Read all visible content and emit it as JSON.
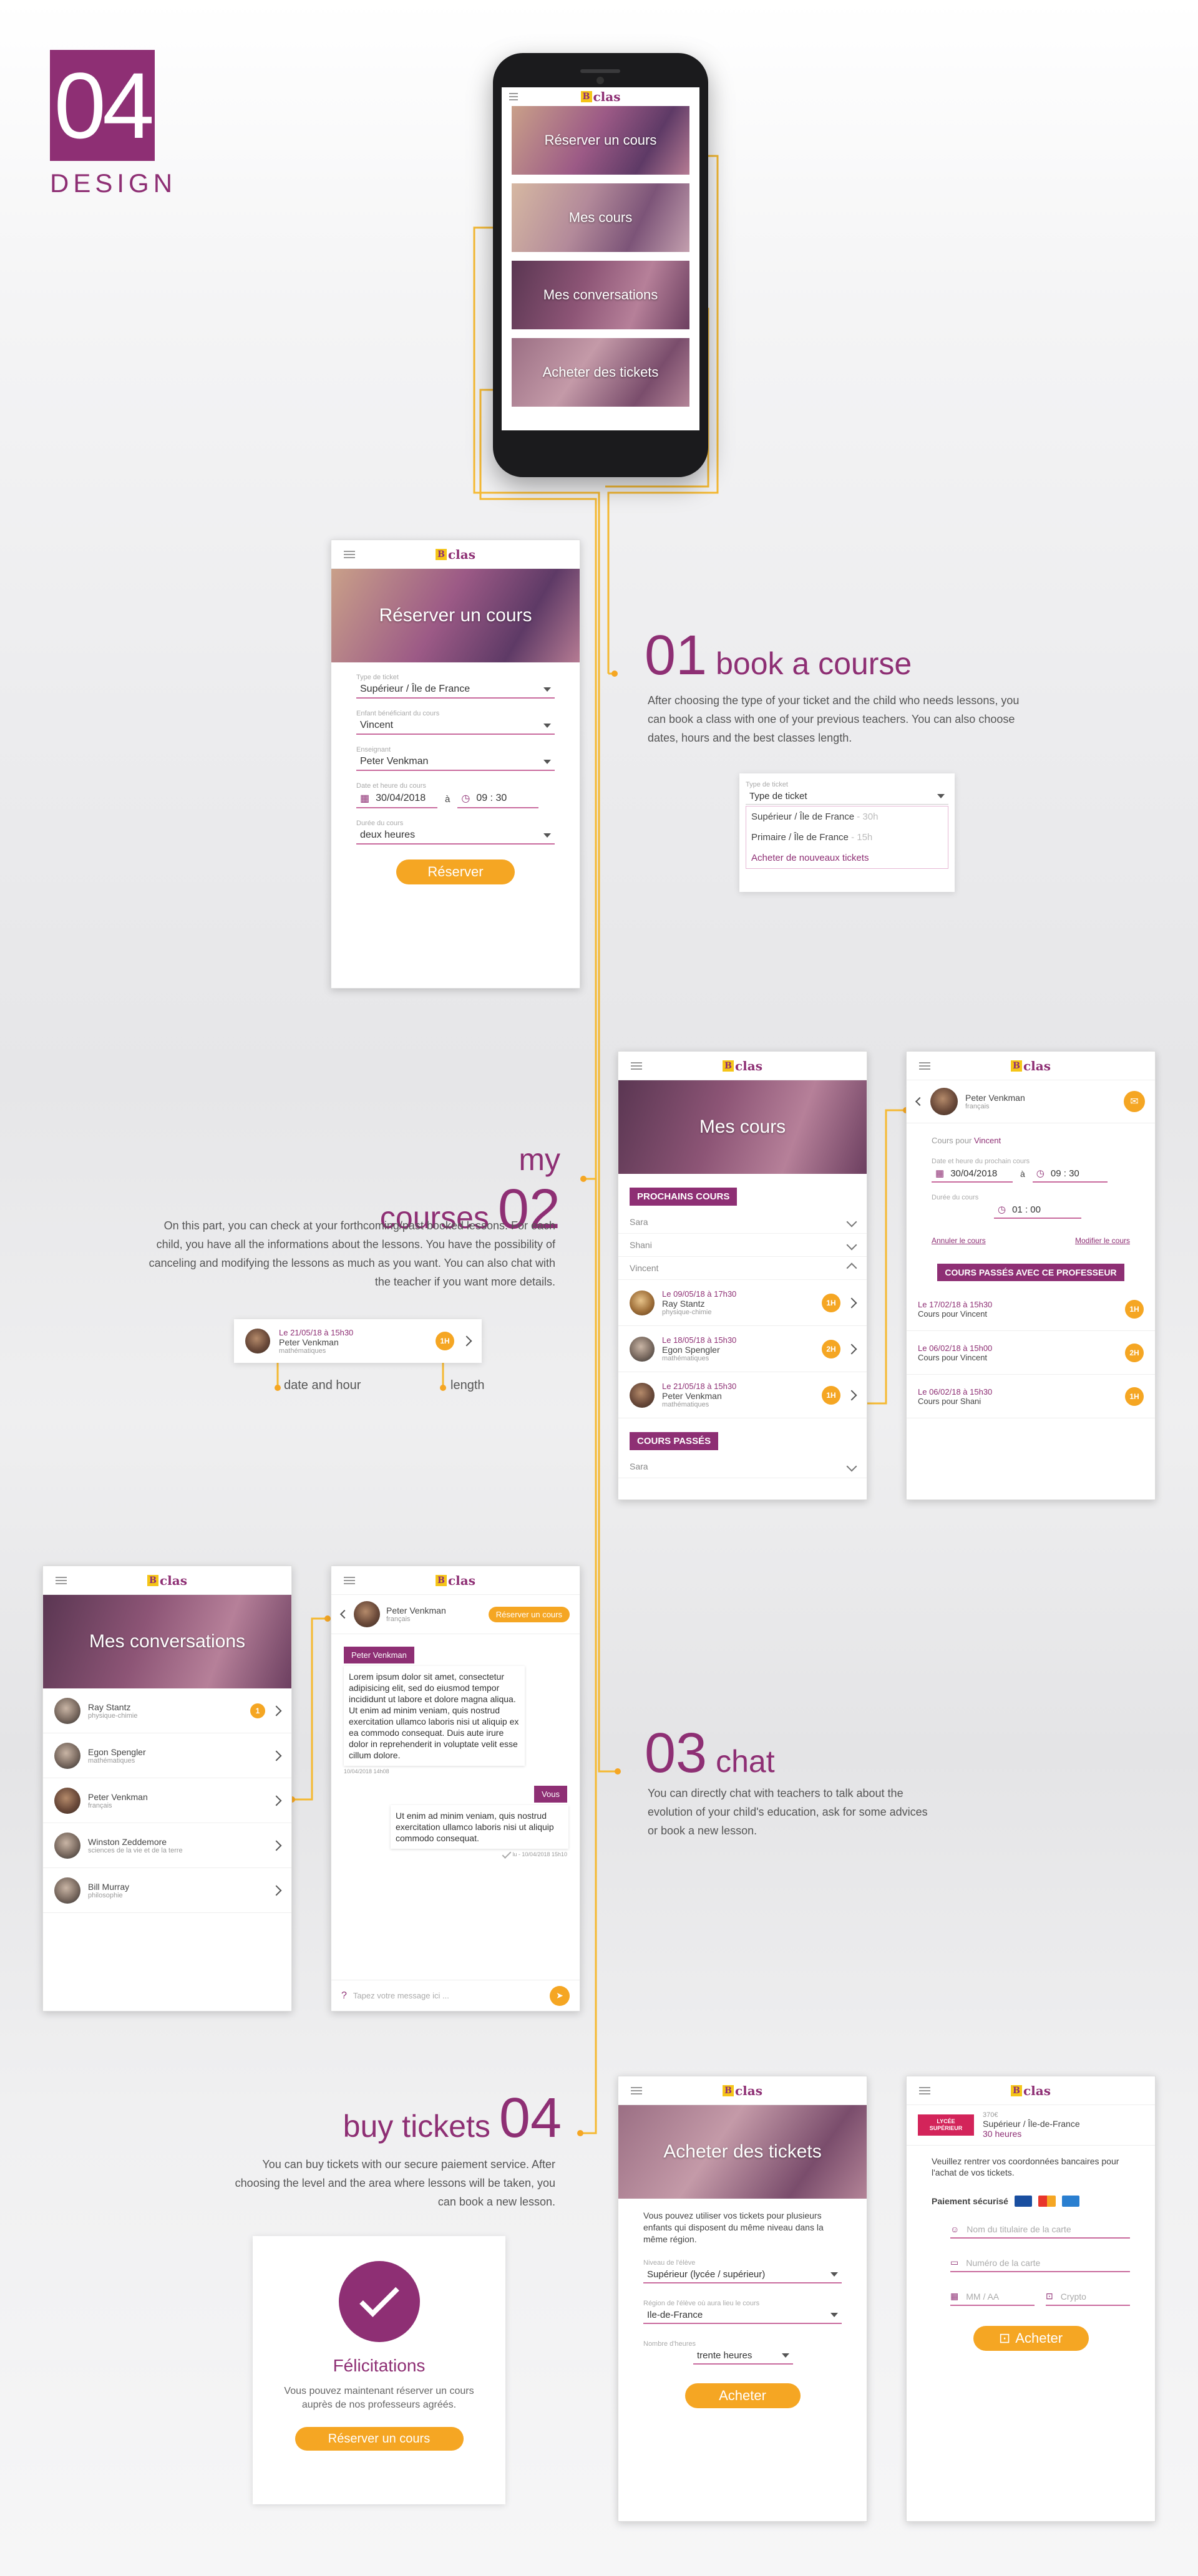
{
  "header": {
    "number": "04",
    "label": "DESIGN"
  },
  "logo": {
    "text": "clas"
  },
  "phone": {
    "tiles": [
      "Réserver un cours",
      "Mes cours",
      "Mes conversations",
      "Acheter des tickets"
    ]
  },
  "book": {
    "hero": "Réserver un cours",
    "type_label": "Type de ticket",
    "type_value": "Supérieur / Île de France",
    "child_label": "Enfant bénéficiant du cours",
    "child_value": "Vincent",
    "teacher_label": "Enseignant",
    "teacher_value": "Peter Venkman",
    "date_label": "Date et heure du cours",
    "date_value": "30/04/2018",
    "a": "à",
    "time_value": "09 : 30",
    "dur_label": "Durée du cours",
    "dur_value": "deux heures",
    "btn": "Réserver"
  },
  "sec01": {
    "num": "01",
    "title": "book a course",
    "text": "After choosing the type of your ticket and the child who needs lessons, you can book a class with one of your previous teachers. You can also choose dates, hours and the best classes length."
  },
  "dropdown": {
    "label": "Type de ticket",
    "value": "Type de ticket",
    "opt1": "Supérieur / Île de France",
    "opt1_extra": "- 30h",
    "opt2": "Primaire / Île de France",
    "opt2_extra": "- 15h",
    "opt3": "Acheter de nouveaux tickets"
  },
  "sec02": {
    "num": "02",
    "title": "my courses",
    "text": "On this part, you can check at your forthcoming/past booked lessons. For each child, you have all the informations about the lessons. You have the possibility of canceling and modifying the lessons as much as you want. You can also chat with the teacher if you want more details."
  },
  "legend": {
    "date": "Le 21/05/18 à 15h30",
    "name": "Peter Venkman",
    "subject": "mathématiques",
    "dur": "1H",
    "date_label": "date and hour",
    "length_label": "length"
  },
  "mescours": {
    "hero": "Mes cours",
    "upcoming": "PROCHAINS COURS",
    "children": [
      "Sara",
      "Shani",
      "Vincent"
    ],
    "items": [
      {
        "date": "Le 09/05/18 à 17h30",
        "name": "Ray Stantz",
        "subject": "physique-chimie",
        "dur": "1H"
      },
      {
        "date": "Le 18/05/18 à 15h30",
        "name": "Egon Spengler",
        "subject": "mathématiques",
        "dur": "2H"
      },
      {
        "date": "Le 21/05/18 à 15h30",
        "name": "Peter Venkman",
        "subject": "mathématiques",
        "dur": "1H"
      }
    ],
    "past": "COURS PASSÉS",
    "past_child": "Sara"
  },
  "detail": {
    "name": "Peter Venkman",
    "subject": "français",
    "course_for": "Cours pour",
    "child": "Vincent",
    "date_label": "Date et heure du prochain cours",
    "date": "30/04/2018",
    "a": "à",
    "time": "09 : 30",
    "dur_label": "Durée du cours",
    "dur": "01 : 00",
    "cancel": "Annuler le cours",
    "modify": "Modifier le cours",
    "past_title": "COURS PASSÉS AVEC CE PROFESSEUR",
    "past": [
      {
        "date": "Le 17/02/18 à 15h30",
        "who": "Cours pour Vincent",
        "dur": "1H"
      },
      {
        "date": "Le 06/02/18 à 15h00",
        "who": "Cours pour Vincent",
        "dur": "2H"
      },
      {
        "date": "Le 06/02/18 à 15h30",
        "who": "Cours pour Shani",
        "dur": "1H"
      }
    ]
  },
  "conv": {
    "hero": "Mes conversations",
    "items": [
      {
        "name": "Ray Stantz",
        "subject": "physique-chimie",
        "count": "1"
      },
      {
        "name": "Egon Spengler",
        "subject": "mathématiques"
      },
      {
        "name": "Peter Venkman",
        "subject": "français"
      },
      {
        "name": "Winston Zeddemore",
        "subject": "sciences de la vie et de la terre"
      },
      {
        "name": "Bill Murray",
        "subject": "philosophie"
      }
    ]
  },
  "chat": {
    "name": "Peter Venkman",
    "subject": "français",
    "book_btn": "Réserver un cours",
    "teacher_tag": "Peter Venkman",
    "msg1": "Lorem ipsum dolor sit amet, consectetur adipisicing elit, sed do eiusmod tempor incididunt ut labore et dolore magna aliqua. Ut enim ad minim veniam, quis nostrud exercitation ullamco laboris nisi ut aliquip ex ea commodo consequat. Duis aute irure dolor in reprehenderit in voluptate velit esse cillum dolore.",
    "msg1_time": "10/04/2018 14h08",
    "vous": "Vous",
    "msg2": "Ut enim ad minim veniam, quis nostrud exercitation ullamco laboris nisi ut aliquip commodo consequat.",
    "msg2_time": "lu - 10/04/2018 15h10",
    "placeholder": "Tapez votre message ici ..."
  },
  "sec03": {
    "num": "03",
    "title": "chat",
    "text": "You can directly chat with teachers to talk about the evolution of your child's education, ask for some advices or book a new lesson."
  },
  "sec04": {
    "num": "04",
    "title": "buy tickets",
    "text": "You can buy tickets with our secure paiement service. After choosing the level and the area where lessons will be taken, you can book a new lesson."
  },
  "success": {
    "title": "Félicitations",
    "text": "Vous pouvez maintenant réserver un cours auprès de nos professeurs agréés.",
    "btn": "Réserver un cours"
  },
  "buy": {
    "hero": "Acheter des tickets",
    "intro": "Vous pouvez utiliser vos tickets pour plusieurs enfants qui disposent du même niveau dans la même région.",
    "level_label": "Niveau de l'élève",
    "level_value": "Supérieur (lycée / supérieur)",
    "region_label": "Région de l'élève où aura lieu le cours",
    "region_value": "Ile-de-France",
    "hours_label": "Nombre d'heures",
    "hours_value": "trente heures",
    "btn": "Acheter"
  },
  "pay": {
    "ticket_tag": "LYCÉE SUPÉRIEUR",
    "price": "370€",
    "level": "Supérieur / Île-de-France",
    "hours": "30 heures",
    "intro": "Veuillez rentrer vos coordonnées bancaires pour l'achat de vos tickets.",
    "secure": "Paiement sécurisé",
    "holder": "Nom du titulaire de la carte",
    "card": "Numéro de la carte",
    "exp": "MM / AA",
    "cvv": "Crypto",
    "btn": "Acheter"
  },
  "colors": {
    "accent": "#8e2f74",
    "orange": "#f5a623"
  }
}
